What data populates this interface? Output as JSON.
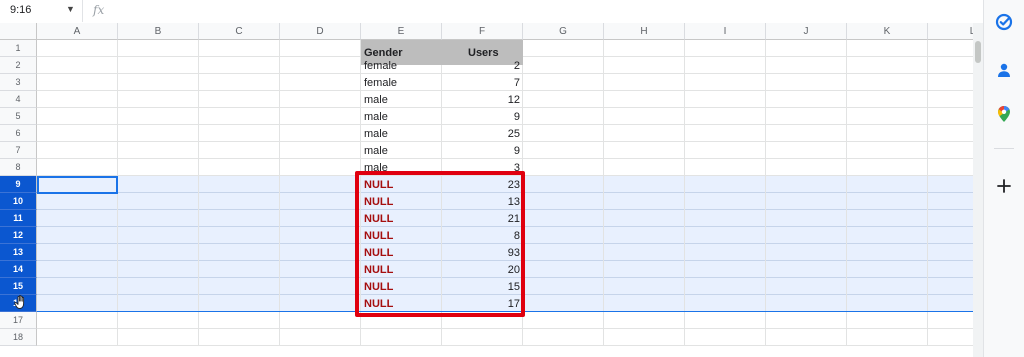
{
  "formula_bar": {
    "name_box": "9:16",
    "fx_label": "fx",
    "formula": ""
  },
  "columns": [
    "A",
    "B",
    "C",
    "D",
    "E",
    "F",
    "G",
    "H",
    "I",
    "J",
    "K",
    "L"
  ],
  "rows": [
    "1",
    "2",
    "3",
    "4",
    "5",
    "6",
    "7",
    "8",
    "9",
    "10",
    "11",
    "12",
    "13",
    "14",
    "15",
    "16",
    "17",
    "18"
  ],
  "selected_rows": [
    "9",
    "10",
    "11",
    "12",
    "13",
    "14",
    "15",
    "16"
  ],
  "table": {
    "headers": {
      "gender": "Gender",
      "users": "Users"
    },
    "data": [
      {
        "gender": "female",
        "users": "2"
      },
      {
        "gender": "female",
        "users": "7"
      },
      {
        "gender": "male",
        "users": "12"
      },
      {
        "gender": "male",
        "users": "9"
      },
      {
        "gender": "male",
        "users": "25"
      },
      {
        "gender": "male",
        "users": "9"
      },
      {
        "gender": "male",
        "users": "3"
      },
      {
        "gender": "NULL",
        "users": "23"
      },
      {
        "gender": "NULL",
        "users": "13"
      },
      {
        "gender": "NULL",
        "users": "21"
      },
      {
        "gender": "NULL",
        "users": "8"
      },
      {
        "gender": "NULL",
        "users": "93"
      },
      {
        "gender": "NULL",
        "users": "20"
      },
      {
        "gender": "NULL",
        "users": "15"
      },
      {
        "gender": "NULL",
        "users": "17"
      }
    ]
  },
  "side_panel": {
    "icons": [
      "tasks-icon",
      "contacts-icon",
      "maps-icon",
      "add-icon"
    ]
  },
  "colors": {
    "selection_header": "#0b57d0",
    "selection_fill": "#e8f0fe",
    "highlight_border": "#e0000f",
    "null_text": "#a50e0e",
    "table_header_fill": "#bdbdbd"
  }
}
